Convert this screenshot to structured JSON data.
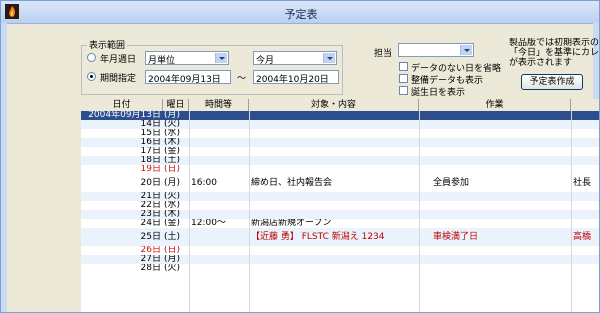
{
  "window": {
    "title": "予定表"
  },
  "range": {
    "group_label": "表示範囲",
    "option1_label": "年月週日",
    "option2_label": "期間指定",
    "unit_value": "月単位",
    "month_value": "今月",
    "start_date": "2004年09月13日",
    "tilde": "〜",
    "end_date": "2004年10月20日"
  },
  "filters": {
    "assignee_label": "担当",
    "assignee_value": "",
    "hide_empty_label": "データのない日を省略",
    "show_repair_label": "整備データも表示",
    "show_birthday_label": "誕生日を表示"
  },
  "note_text": [
    "製品版では初期表示の範",
    "「今日」を基準にカレンダ",
    "が表示されます"
  ],
  "create_button": "予定表作成",
  "table": {
    "headers": [
      "日付",
      "曜日",
      "時間等",
      "対象・内容",
      "作業"
    ],
    "rows": [
      {
        "date": "2004年09月13日",
        "dow": "(月)",
        "time": "",
        "content": "",
        "work": "",
        "extra": "",
        "style": "sel"
      },
      {
        "date": "14日",
        "dow": "(火)",
        "time": "",
        "content": "",
        "work": "",
        "extra": "",
        "style": "alt"
      },
      {
        "date": "15日",
        "dow": "(水)",
        "time": "",
        "content": "",
        "work": "",
        "extra": "",
        "style": ""
      },
      {
        "date": "16日",
        "dow": "(木)",
        "time": "",
        "content": "",
        "work": "",
        "extra": "",
        "style": "alt"
      },
      {
        "date": "17日",
        "dow": "(金)",
        "time": "",
        "content": "",
        "work": "",
        "extra": "",
        "style": ""
      },
      {
        "date": "18日",
        "dow": "(土)",
        "time": "",
        "content": "",
        "work": "",
        "extra": "",
        "style": "alt"
      },
      {
        "date": "19日",
        "dow": "(日)",
        "time": "",
        "content": "",
        "work": "",
        "extra": "",
        "style": "",
        "color": "#d01010"
      },
      {
        "date": "20日",
        "dow": "(月)",
        "time": "16:00",
        "content": "締め日、社内報告会",
        "work": "全員参加",
        "extra": "社長",
        "style": "big"
      },
      {
        "date": "21日",
        "dow": "(火)",
        "time": "",
        "content": "",
        "work": "",
        "extra": "",
        "style": "alt"
      },
      {
        "date": "22日",
        "dow": "(水)",
        "time": "",
        "content": "",
        "work": "",
        "extra": "",
        "style": ""
      },
      {
        "date": "23日",
        "dow": "(木)",
        "time": "",
        "content": "",
        "work": "",
        "extra": "",
        "style": "alt"
      },
      {
        "date": "24日",
        "dow": "(金)",
        "time": "12:00〜",
        "content": "新潟店新規オープン",
        "work": "",
        "extra": "",
        "style": ""
      },
      {
        "date": "25日",
        "dow": "(土)",
        "time": "",
        "content": "【近藤 勇】 FLSTC 新潟え 1234",
        "work": "車検満了日",
        "extra": "高橋",
        "style": "big alt",
        "textColor": "#c00000"
      },
      {
        "date": "26日",
        "dow": "(日)",
        "time": "",
        "content": "",
        "work": "",
        "extra": "",
        "style": "",
        "color": "#d01010"
      },
      {
        "date": "27日",
        "dow": "(月)",
        "time": "",
        "content": "",
        "work": "",
        "extra": "",
        "style": "alt"
      },
      {
        "date": "28日",
        "dow": "(火)",
        "time": "",
        "content": "",
        "work": "",
        "extra": "",
        "style": ""
      }
    ]
  }
}
